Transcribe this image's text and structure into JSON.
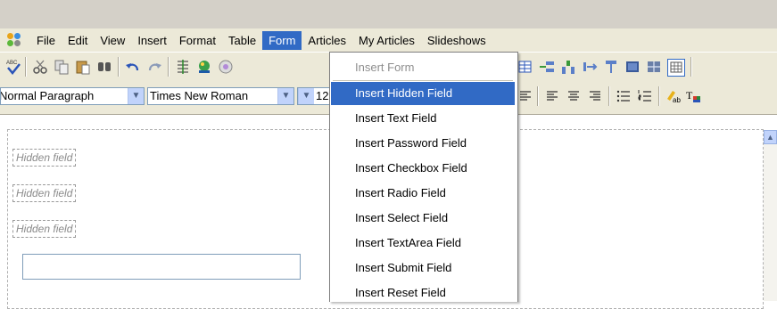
{
  "menubar": {
    "items": [
      "File",
      "Edit",
      "View",
      "Insert",
      "Format",
      "Table",
      "Form",
      "Articles",
      "My Articles",
      "Slideshows"
    ],
    "active_index": 6
  },
  "format_bar": {
    "paragraph_style": "Normal Paragraph",
    "font_family": "Times New Roman",
    "font_size": "12"
  },
  "editor": {
    "hidden_fields": [
      "Hidden field",
      "Hidden field",
      "Hidden field"
    ]
  },
  "form_menu": {
    "header": "Insert Form",
    "items": [
      "Insert Hidden Field",
      "Insert Text Field",
      "Insert Password Field",
      "Insert Checkbox Field",
      "Insert Radio Field",
      "Insert Select Field",
      "Insert TextArea Field",
      "Insert Submit Field",
      "Insert Reset Field"
    ],
    "highlighted_index": 0
  },
  "colors": {
    "highlight": "#316ac5",
    "chrome": "#ece9d8"
  }
}
